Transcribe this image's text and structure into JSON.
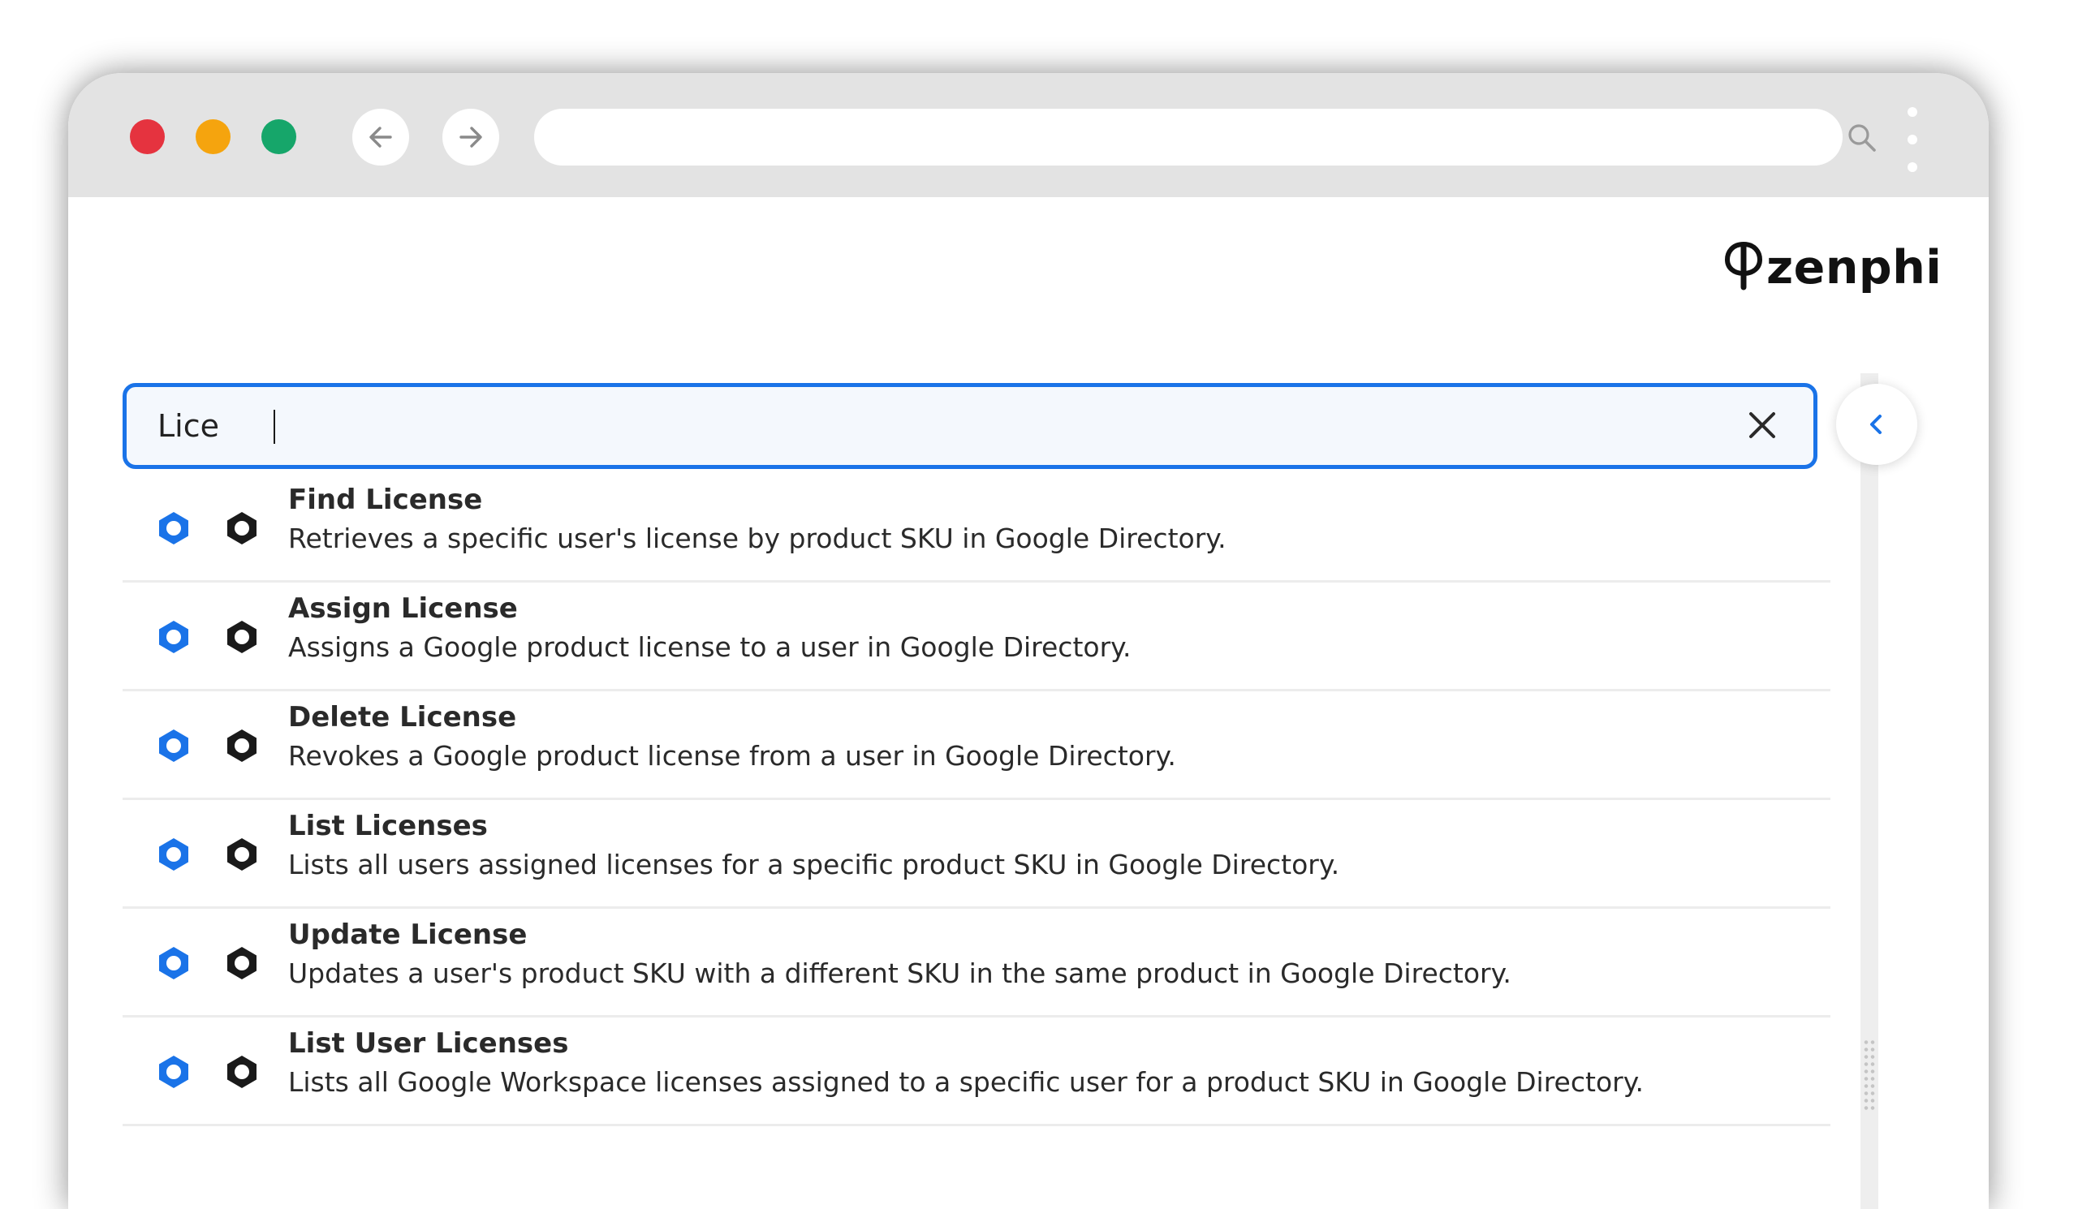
{
  "colors": {
    "traffic_red": "#e5333f",
    "traffic_yellow": "#f5a40e",
    "traffic_green": "#16a66a",
    "accent": "#1a73e8",
    "product_icon_blue": "#1a73e8",
    "product_icon_black": "#1a1a1a"
  },
  "browser": {
    "url": "",
    "back_icon": "arrow-left-icon",
    "forward_icon": "arrow-right-icon",
    "search_icon": "search-icon",
    "menu_icon": "more-vert-icon"
  },
  "brand": {
    "logo_text": "zenphi",
    "logo_icon": "zenphi-logo-icon"
  },
  "search": {
    "value": "Lice",
    "clear_icon": "close-icon"
  },
  "panel": {
    "collapse_icon": "chevron-left-icon"
  },
  "results": [
    {
      "title": "Find License",
      "description": "Retrieves a specific user's license by product SKU in Google Directory."
    },
    {
      "title": "Assign License",
      "description": "Assigns a Google product license to a user in Google Directory."
    },
    {
      "title": "Delete License",
      "description": "Revokes a Google product license from a user in Google Directory."
    },
    {
      "title": "List Licenses",
      "description": "Lists all users assigned licenses for a specific product SKU in Google Directory."
    },
    {
      "title": "Update License",
      "description": "Updates a user's product SKU with a different SKU in the same product in Google Directory."
    },
    {
      "title": "List User Licenses",
      "description": "Lists all Google Workspace licenses assigned to a specific user for a product SKU in Google Directory."
    }
  ]
}
